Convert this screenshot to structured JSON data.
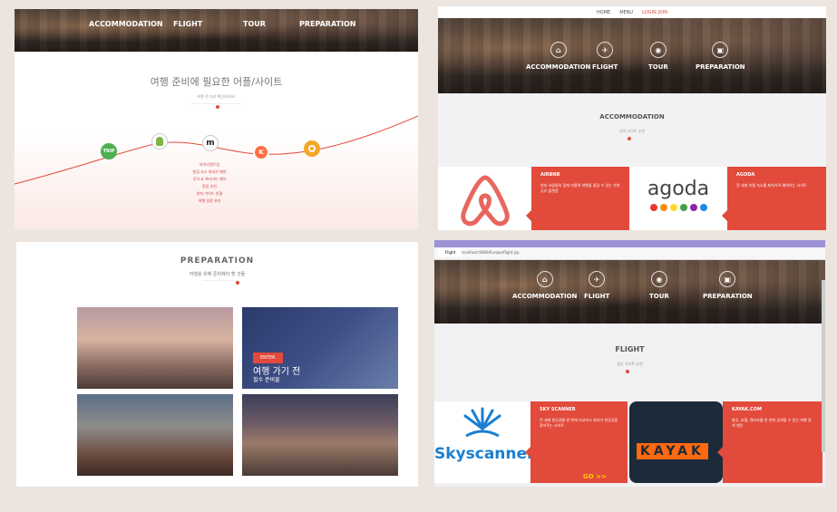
{
  "panel1": {
    "nav": [
      "ACCOMMODATION",
      "FLIGHT",
      "TOUR",
      "PREPARATION"
    ],
    "title": "여행 준비에 필요한 어플/사이트",
    "subtitle": "여행 전 미리 확인하세요!",
    "apps": [
      {
        "icon": "trip-icon",
        "text": "TRIP",
        "color": "#4caf50"
      },
      {
        "icon": "android-icon",
        "text": "",
        "color": "#7cb342"
      },
      {
        "icon": "m-icon",
        "text": "m",
        "color": "#ffffff"
      },
      {
        "icon": "k-icon",
        "text": "K",
        "color": "#ff7043"
      },
      {
        "icon": "wifi-icon",
        "text": "",
        "color": "#f5a623"
      }
    ],
    "list": [
      "마이리얼트립",
      "항공,숙소 최저가 예약",
      "투어 & 액티비티 예약",
      "맛집 추천",
      "현지 가이드 연결",
      "여행 일정 관리"
    ]
  },
  "panel2": {
    "topnav": [
      "HOME",
      "MENU",
      "LOGIN JOIN"
    ],
    "nav": [
      "ACCOMMODATION",
      "FLIGHT",
      "TOUR",
      "PREPARATION"
    ],
    "section_title": "ACCOMMODATION",
    "section_sub": "숙박 사이트 추천",
    "cards": [
      {
        "name": "AIRBNB",
        "text": "현지 사람들의 집에 머물며 여행을 즐길 수 있는 숙박 공유 플랫폼"
      },
      {
        "name": "AGODA",
        "text": "전 세계 호텔 숙소를 최저가로 예약하는 사이트"
      }
    ],
    "agoda_logo": "agoda"
  },
  "panel3": {
    "title": "PREPARATION",
    "subtitle": "여행을 위해 준비해야 할 것들",
    "badge": "ENTER",
    "caption_main": "여행 가기 전",
    "caption_sub": "필수 준비물"
  },
  "panel4": {
    "tab": "Flight",
    "url": "localhost:8080/Europe/flight.jsp",
    "nav": [
      "ACCOMMODATION",
      "FLIGHT",
      "TOUR",
      "PREPARATION"
    ],
    "section_title": "FLIGHT",
    "section_sub": "항공 사이트 추천",
    "cards": [
      {
        "name": "SKY SCANNER",
        "text": "전 세계 항공권을 한 번에 비교하고 최저가 항공권을 찾아주는 사이트"
      },
      {
        "name": "KAYAK.COM",
        "text": "항공, 호텔, 렌터카를 한 번에 검색할 수 있는 여행 검색 엔진"
      }
    ],
    "skyscanner_logo": "Skyscanner",
    "kayak_logo": "KAYAK",
    "go_label": "GO >>"
  }
}
